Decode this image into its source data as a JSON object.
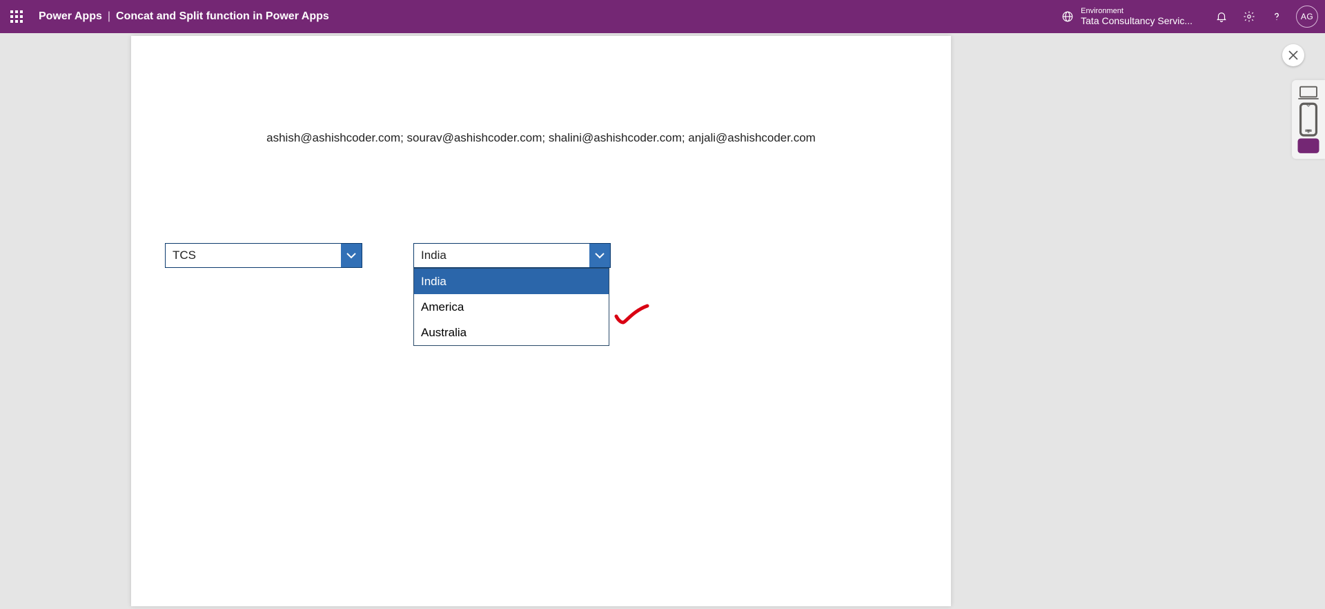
{
  "header": {
    "brand": "Power Apps",
    "divider": "|",
    "app_name": "Concat and Split function in Power Apps",
    "environment_label": "Environment",
    "environment_value": "Tata Consultancy Servic...",
    "avatar_initials": "AG"
  },
  "canvas": {
    "email_line": "ashish@ashishcoder.com; sourav@ashishcoder.com; shalini@ashishcoder.com; anjali@ashishcoder.com",
    "company_dropdown": {
      "value": "TCS"
    },
    "country_dropdown": {
      "value": "India",
      "options": [
        "India",
        "America",
        "Australia"
      ],
      "selected_index": 0
    }
  }
}
